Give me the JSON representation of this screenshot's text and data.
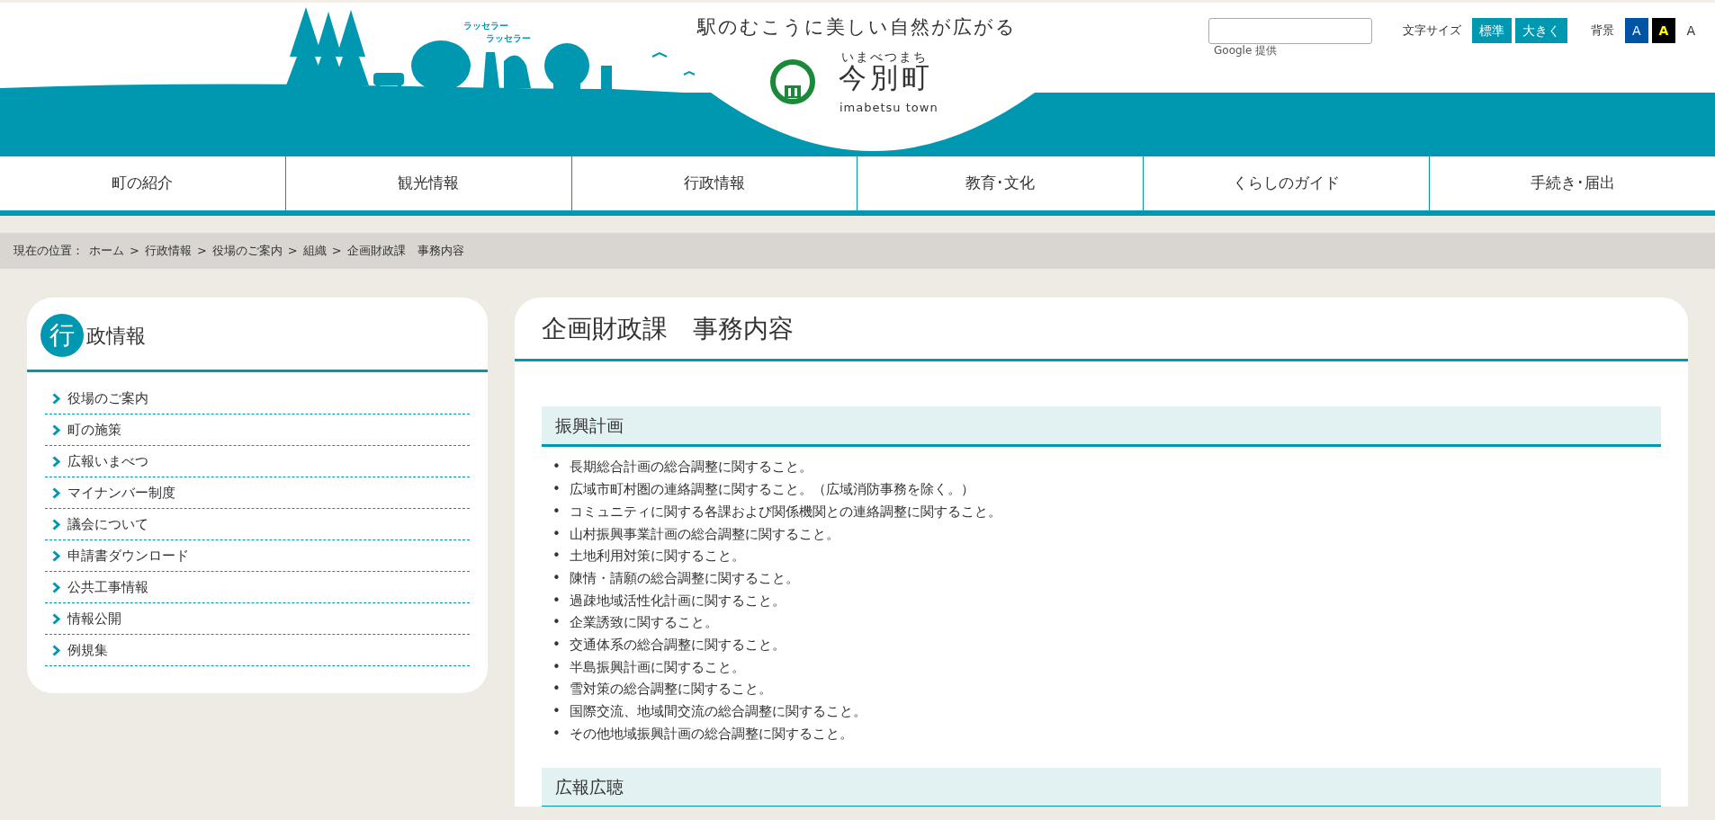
{
  "header": {
    "tagline": "駅のむこうに美しい自然が広がる",
    "illustration_texts": [
      "ラッセラー",
      "ラッセラー"
    ],
    "logo": {
      "reading": "いまべつまち",
      "name": "今別町",
      "romaji": "imabetsu town"
    },
    "search": {
      "credit_brand": "Google",
      "credit_text": "提供"
    },
    "font_size": {
      "label": "文字サイズ",
      "buttons": [
        "標準",
        "大きく"
      ]
    },
    "background": {
      "label": "背景",
      "buttons": [
        {
          "text": "A",
          "kind": "blue"
        },
        {
          "text": "A",
          "kind": "black"
        },
        {
          "text": "A",
          "kind": "white"
        }
      ]
    }
  },
  "nav": [
    "町の紹介",
    "観光情報",
    "行政情報",
    "教育･文化",
    "くらしのガイド",
    "手続き･届出"
  ],
  "breadcrumb": {
    "label": "現在の位置：",
    "items": [
      "ホーム",
      "行政情報",
      "役場のご案内",
      "組織",
      "企画財政課　事務内容"
    ],
    "separators": [
      ">",
      ">",
      ">",
      ">"
    ]
  },
  "sidebar": {
    "title_initial": "行",
    "title_rest": "政情報",
    "items": [
      "役場のご案内",
      "町の施策",
      "広報いまべつ",
      "マイナンバー制度",
      "議会について",
      "申請書ダウンロード",
      "公共工事情報",
      "情報公開",
      "例規集"
    ]
  },
  "content": {
    "title": "企画財政課　事務内容",
    "sections": [
      {
        "heading": "振興計画",
        "items": [
          {
            "bullet": "•",
            "text": "長期総合計画の総合調整に関すること。"
          },
          {
            "bullet": "•",
            "text": "広域市町村圏の連絡調整に関すること。（広域消防事務を除く。）"
          },
          {
            "bullet": "•",
            "text": "コミュニティに関する各課および関係機関との連絡調整に関すること。"
          },
          {
            "bullet": "•",
            "text": "山村振興事業計画の総合調整に関すること。"
          },
          {
            "bullet": "•",
            "text": "土地利用対策に関すること。"
          },
          {
            "bullet": "•",
            "text": "陳情・請願の総合調整に関すること。"
          },
          {
            "bullet": "•",
            "text": "過疎地域活性化計画に関すること。"
          },
          {
            "bullet": "•",
            "text": "企業誘致に関すること。"
          },
          {
            "bullet": "•",
            "text": "交通体系の総合調整に関すること。"
          },
          {
            "bullet": "•",
            "text": "半島振興計画に関すること。"
          },
          {
            "bullet": "•",
            "text": "雪対策の総合調整に関すること。"
          },
          {
            "bullet": "•",
            "text": "国際交流、地域間交流の総合調整に関すること。"
          },
          {
            "bullet": "•",
            "text": "その他地域振興計画の総合調整に関すること。"
          }
        ]
      },
      {
        "heading": "広報広聴"
      }
    ]
  }
}
